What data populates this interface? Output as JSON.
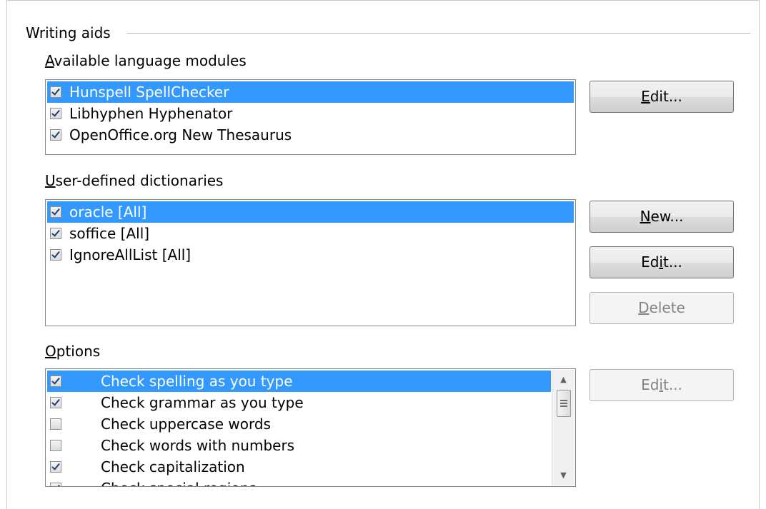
{
  "writing_aids": {
    "title": "Writing aids",
    "language_modules": {
      "label_accel": "A",
      "label_rest": "vailable language modules",
      "items": [
        {
          "label": "Hunspell SpellChecker",
          "checked": true,
          "selected": true
        },
        {
          "label": "Libhyphen Hyphenator",
          "checked": true,
          "selected": false
        },
        {
          "label": "OpenOffice.org New Thesaurus",
          "checked": true,
          "selected": false
        }
      ],
      "edit_button": {
        "pre": "",
        "accel": "E",
        "post": "dit..."
      }
    },
    "dictionaries": {
      "label_accel": "U",
      "label_rest": "ser-defined dictionaries",
      "items": [
        {
          "label": "oracle [All]",
          "checked": true,
          "selected": true
        },
        {
          "label": "soffice [All]",
          "checked": true,
          "selected": false
        },
        {
          "label": "IgnoreAllList [All]",
          "checked": true,
          "selected": false
        }
      ],
      "new_button": {
        "pre": "",
        "accel": "N",
        "post": "ew..."
      },
      "edit_button": {
        "pre": "Ed",
        "accel": "i",
        "post": "t..."
      },
      "delete_button": {
        "pre": "",
        "accel": "D",
        "post": "elete"
      }
    },
    "options": {
      "label_accel": "O",
      "label_rest": "ptions",
      "items": [
        {
          "label": "Check spelling as you type",
          "checked": true,
          "selected": true
        },
        {
          "label": "Check grammar as you type",
          "checked": true,
          "selected": false
        },
        {
          "label": "Check uppercase words",
          "checked": false,
          "selected": false
        },
        {
          "label": "Check words with numbers",
          "checked": false,
          "selected": false
        },
        {
          "label": "Check capitalization",
          "checked": true,
          "selected": false
        },
        {
          "label": "Check special regions",
          "checked": true,
          "selected": false
        }
      ],
      "edit_button": {
        "pre": "Ed",
        "accel": "i",
        "post": "t..."
      }
    }
  }
}
